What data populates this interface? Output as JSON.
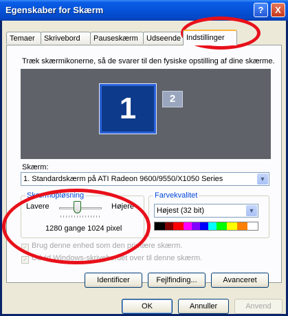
{
  "window": {
    "title": "Egenskaber for Skærm",
    "help_label": "?",
    "close_label": "X"
  },
  "tabs": [
    {
      "label": "Temaer"
    },
    {
      "label": "Skrivebord"
    },
    {
      "label": "Pauseskærm"
    },
    {
      "label": "Udseende"
    },
    {
      "label": "Indstillinger"
    }
  ],
  "settings": {
    "instruction": "Træk skærmikonerne, så de svarer til den fysiske opstilling af dine skærme.",
    "monitors": [
      "1",
      "2"
    ],
    "screen_label": "Skærm:",
    "screen_value": "1. Standardskærm på ATI Radeon 9600/9550/X1050 Series",
    "resolution": {
      "group_title": "Skærmopløsning",
      "less_label": "Lavere",
      "more_label": "Højere",
      "value_text": "1280 gange 1024 pixel"
    },
    "color": {
      "group_title": "Farvekvalitet",
      "value": "Højest (32 bit)"
    },
    "checkboxes": [
      {
        "label": "Brug denne enhed som den primære skærm.",
        "checked": true,
        "enabled": false
      },
      {
        "label": "Udvid Windows-skrivebordet over til denne skærm.",
        "checked": true,
        "enabled": false
      }
    ],
    "buttons": {
      "identify": "Identificer",
      "troubleshoot": "Fejlfinding...",
      "advanced": "Avanceret"
    }
  },
  "footer": {
    "ok": "OK",
    "cancel": "Annuller",
    "apply": "Anvend"
  },
  "colors": {
    "title_bar": "#0553d8",
    "dialog_bg": "#ece9d8",
    "annotation": "#e8101a",
    "group_title": "#0046d5"
  }
}
